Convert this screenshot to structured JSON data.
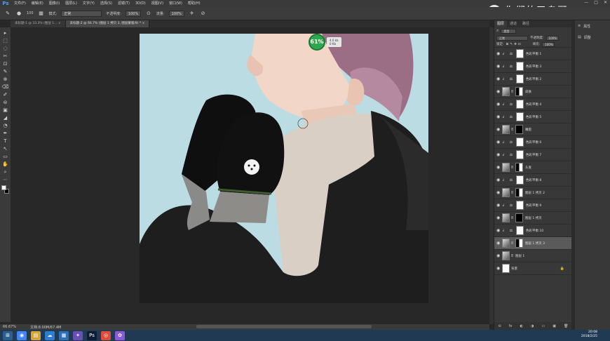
{
  "menubar": {
    "logo": "Ps",
    "items": [
      "文件(F)",
      "编辑(E)",
      "图像(I)",
      "图层(L)",
      "文字(Y)",
      "选择(S)",
      "滤镜(T)",
      "3D(D)",
      "视图(V)",
      "窗口(W)",
      "帮助(H)"
    ],
    "winctl": [
      "—",
      "□",
      "✕"
    ]
  },
  "watermark": {
    "text": "你们的又乌哥"
  },
  "optbar": {
    "size": "100",
    "mode_label": "模式:",
    "mode_value": "正常",
    "opacity_label": "不透明度:",
    "opacity_value": "100%",
    "flow_label": "流量:",
    "flow_value": "100%"
  },
  "tabs": [
    {
      "label": "未标题-1 @ 33.3% (图层 1...",
      "close": "×"
    },
    {
      "label": "未标题-2 @ 66.7% (图层 1 拷贝 3, 图层蒙版/8) *",
      "close": "×"
    }
  ],
  "tools": [
    "▸",
    "⬚",
    "◌",
    "✂",
    "⊡",
    "✎",
    "⊕",
    "⌫",
    "✐",
    "⊜",
    "▣",
    "◢",
    "◔",
    "✒",
    "T",
    "↖",
    "▭",
    "✋",
    "⌕",
    "⋯"
  ],
  "zoom_badge": {
    "percent": "61%",
    "line1": "4.0 kb",
    "line2": "0 Kb"
  },
  "status": {
    "zoom": "66.67%",
    "doc": "文档:8.00M/67.4M"
  },
  "layers": {
    "tabs": [
      "图层",
      "通道",
      "路径"
    ],
    "kind_label": "类型",
    "blend_mode": "正常",
    "opacity_label": "不透明度:",
    "opacity_value": "100%",
    "lock_label": "锁定:",
    "fill_label": "填充:",
    "fill_value": "100%",
    "rows": [
      {
        "name": "色彩平衡 1",
        "kind": "adj",
        "mask": "white"
      },
      {
        "name": "色彩平衡 3",
        "kind": "adj",
        "mask": "white"
      },
      {
        "name": "色彩平衡 2",
        "kind": "adj",
        "mask": "white"
      },
      {
        "name": "皮肤",
        "kind": "img",
        "mask": "mixed"
      },
      {
        "name": "色彩平衡 4",
        "kind": "adj",
        "mask": "white"
      },
      {
        "name": "色彩平衡 5",
        "kind": "adj",
        "mask": "white"
      },
      {
        "name": "嘴唇",
        "kind": "img",
        "mask": "dark"
      },
      {
        "name": "色彩平衡 6",
        "kind": "adj",
        "mask": "white"
      },
      {
        "name": "色彩平衡 7",
        "kind": "adj",
        "mask": "white"
      },
      {
        "name": "头发",
        "kind": "img",
        "mask": "mixed"
      },
      {
        "name": "色彩平衡 8",
        "kind": "adj",
        "mask": "white"
      },
      {
        "name": "图层 1 拷贝 2",
        "kind": "img",
        "mask": "mixed"
      },
      {
        "name": "色彩平衡 9",
        "kind": "adj",
        "mask": "white"
      },
      {
        "name": "图层 1 拷贝",
        "kind": "img",
        "mask": "dark"
      },
      {
        "name": "色彩平衡 10",
        "kind": "adj",
        "mask": "white"
      },
      {
        "name": "图层 1 拷贝 3",
        "kind": "img",
        "mask": "mixed",
        "selected": true
      },
      {
        "name": "图层 1",
        "kind": "img",
        "mask": "none"
      },
      {
        "name": "背景",
        "kind": "bg",
        "mask": "none",
        "locked": true
      }
    ],
    "footer": [
      "⊝",
      "fx",
      "◐",
      "◑",
      "▭",
      "▣",
      "🗑"
    ]
  },
  "sidepanel": {
    "items": [
      {
        "icon": "≡",
        "label": "属性"
      },
      {
        "icon": "▤",
        "label": "调整"
      }
    ]
  },
  "clock": {
    "time": "20:08",
    "date": "2018/2/25"
  }
}
